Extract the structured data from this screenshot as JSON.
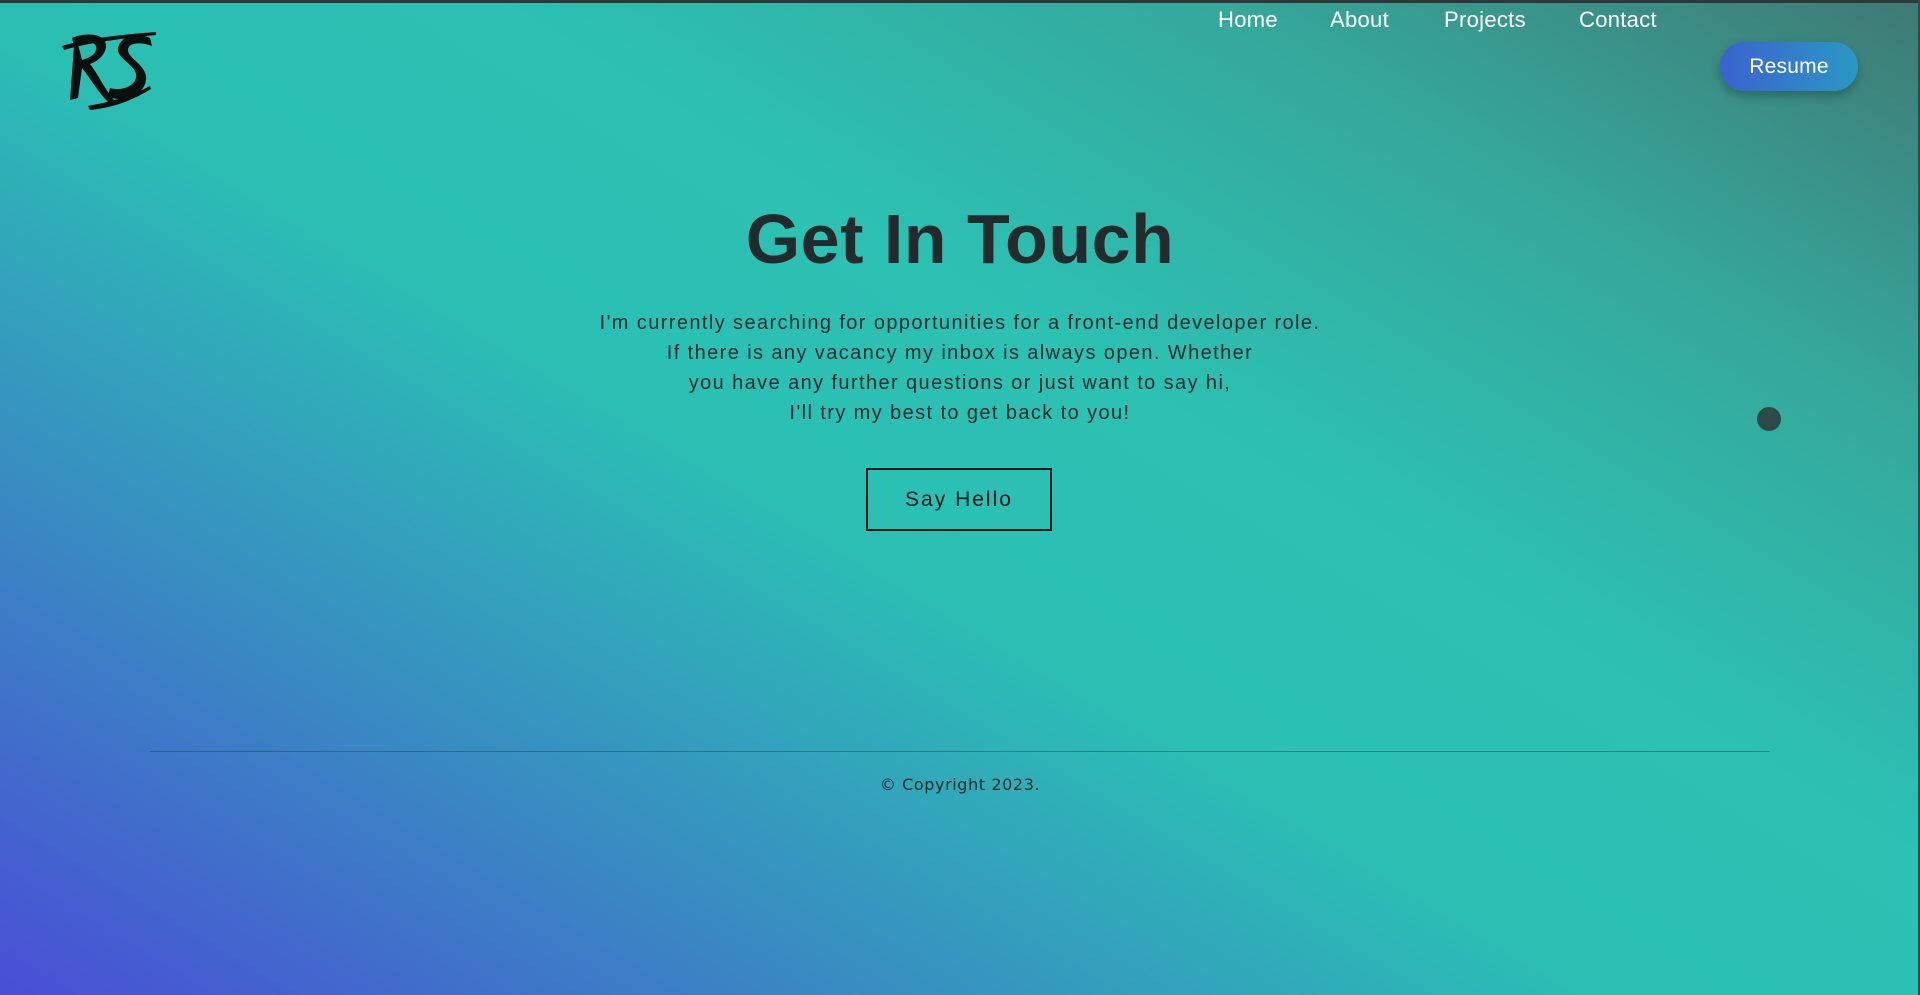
{
  "header": {
    "logo_text": "RS",
    "nav": [
      "Home",
      "About",
      "Projects",
      "Contact"
    ],
    "resume_label": "Resume"
  },
  "main": {
    "title": "Get In Touch",
    "description_lines": [
      "I'm currently searching for opportunities for a front-end developer role.",
      "If there is any vacancy my inbox is always open. Whether",
      "you have any further questions or just want to say hi,",
      "I'll try my best to get back to you!"
    ],
    "cta_label": "Say Hello"
  },
  "footer": {
    "copyright": "© Copyright 2023."
  },
  "colors": {
    "accent_gradient_start": "#4a4ed6",
    "accent_gradient_mid": "#2bbfb4",
    "accent_gradient_end": "#3f7a74",
    "resume_button": "#3b62d0",
    "text_dark": "#222a2b"
  }
}
